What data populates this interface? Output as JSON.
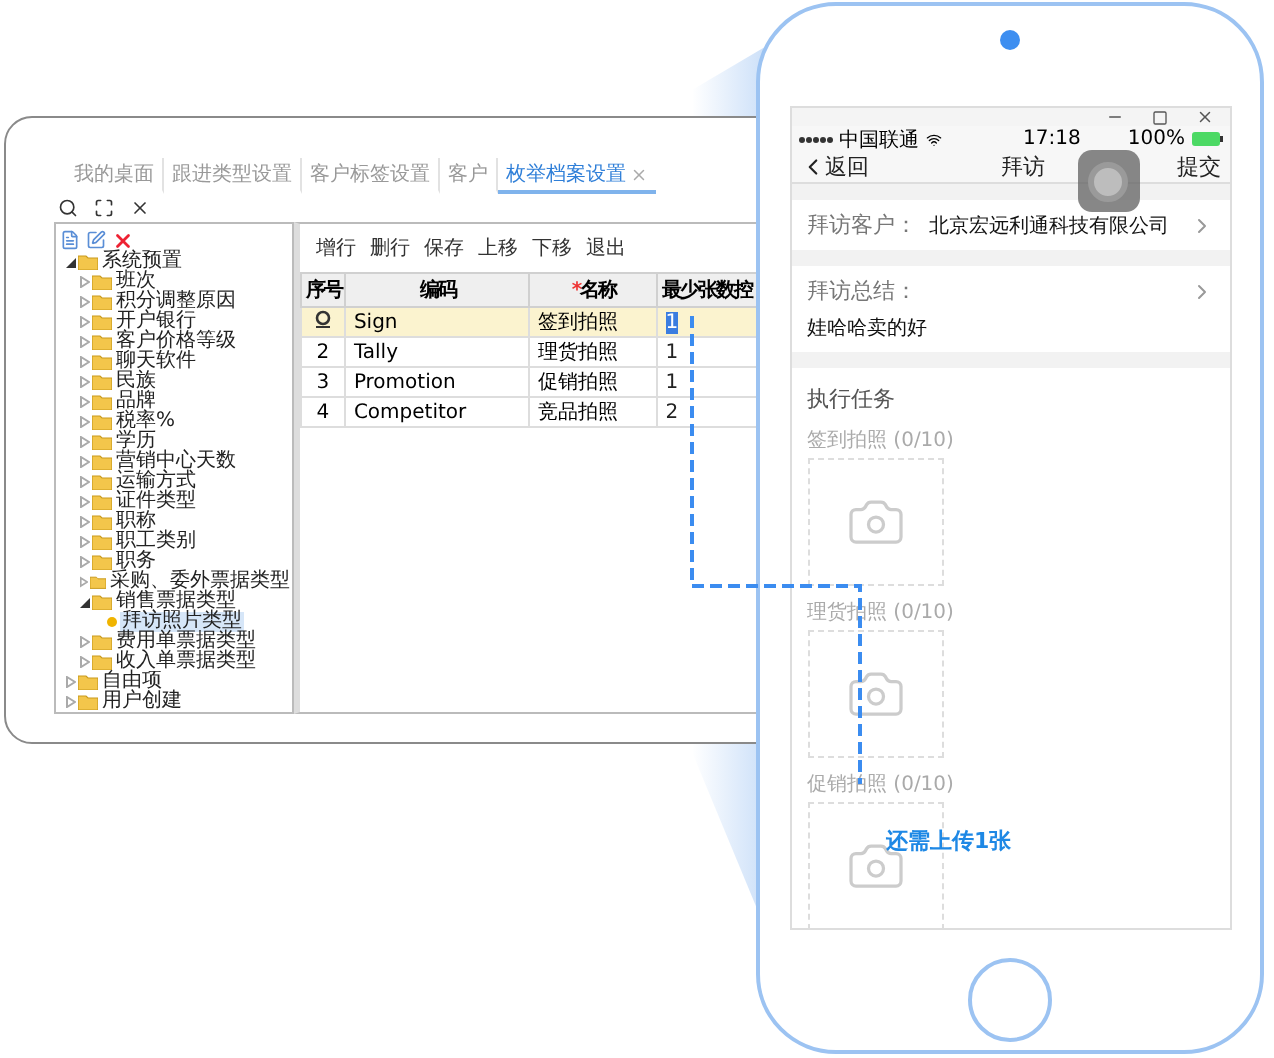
{
  "desktop": {
    "tabs": [
      {
        "label": "我的桌面",
        "selected": false
      },
      {
        "label": "跟进类型设置",
        "selected": false
      },
      {
        "label": "客户标签设置",
        "selected": false
      },
      {
        "label": "客户",
        "selected": false
      },
      {
        "label": "枚举档案设置",
        "selected": true,
        "closable": true
      }
    ],
    "tree": [
      {
        "label": "系统预置",
        "kind": "folder",
        "expanded": true,
        "selected": false,
        "children": [
          {
            "label": "班次",
            "kind": "folder",
            "expanded": false,
            "selected": false
          },
          {
            "label": "积分调整原因",
            "kind": "folder",
            "expanded": false,
            "selected": false
          },
          {
            "label": "开户银行",
            "kind": "folder",
            "expanded": false,
            "selected": false
          },
          {
            "label": "客户价格等级",
            "kind": "folder",
            "expanded": false,
            "selected": false
          },
          {
            "label": "聊天软件",
            "kind": "folder",
            "expanded": false,
            "selected": false
          },
          {
            "label": "民族",
            "kind": "folder",
            "expanded": false,
            "selected": false
          },
          {
            "label": "品牌",
            "kind": "folder",
            "expanded": false,
            "selected": false
          },
          {
            "label": "税率%",
            "kind": "folder",
            "expanded": false,
            "selected": false
          },
          {
            "label": "学历",
            "kind": "folder",
            "expanded": false,
            "selected": false
          },
          {
            "label": "营销中心天数",
            "kind": "folder",
            "expanded": false,
            "selected": false
          },
          {
            "label": "运输方式",
            "kind": "folder",
            "expanded": false,
            "selected": false
          },
          {
            "label": "证件类型",
            "kind": "folder",
            "expanded": false,
            "selected": false
          },
          {
            "label": "职称",
            "kind": "folder",
            "expanded": false,
            "selected": false
          },
          {
            "label": "职工类别",
            "kind": "folder",
            "expanded": false,
            "selected": false
          },
          {
            "label": "职务",
            "kind": "folder",
            "expanded": false,
            "selected": false
          },
          {
            "label": "采购、委外票据类型",
            "kind": "folder",
            "expanded": false,
            "selected": false
          },
          {
            "label": "销售票据类型",
            "kind": "folder",
            "expanded": true,
            "selected": false,
            "children": [
              {
                "label": "拜访照片类型",
                "kind": "item",
                "selected": true
              }
            ]
          },
          {
            "label": "费用单票据类型",
            "kind": "folder",
            "expanded": false,
            "selected": false
          },
          {
            "label": "收入单票据类型",
            "kind": "folder",
            "expanded": false,
            "selected": false
          }
        ]
      },
      {
        "label": "自由项",
        "kind": "folder",
        "expanded": false,
        "selected": false
      },
      {
        "label": "用户创建",
        "kind": "folder",
        "expanded": false,
        "selected": false
      }
    ],
    "toolbar": [
      "增行",
      "删行",
      "保存",
      "上移",
      "下移",
      "退出"
    ],
    "table": {
      "columns": [
        {
          "label": "序号"
        },
        {
          "label": "编码"
        },
        {
          "label": "名称",
          "marker": "*"
        },
        {
          "label": "最少张数控"
        }
      ],
      "rows": [
        {
          "code": "Sign",
          "name": "签到拍照",
          "min": "1",
          "selected": true,
          "editing": true
        },
        {
          "no": "2",
          "code": "Tally",
          "name": "理货拍照",
          "min": "1",
          "selected": false,
          "editing": false
        },
        {
          "no": "3",
          "code": "Promotion",
          "name": "促销拍照",
          "min": "1",
          "selected": false,
          "editing": false
        },
        {
          "no": "4",
          "code": "Competitor",
          "name": "竞品拍照",
          "min": "2",
          "selected": false,
          "editing": false
        }
      ]
    }
  },
  "phone": {
    "status": {
      "carrier": "中国联通",
      "time": "17:18",
      "battery": "100%"
    },
    "nav": {
      "back": "返回",
      "title": "拜访",
      "action": "提交"
    },
    "customer": {
      "label": "拜访客户：",
      "value": "北京宏远利通科技有限公司"
    },
    "summary": {
      "label": "拜访总结：",
      "value": "娃哈哈卖的好"
    },
    "tasks": {
      "title": "执行任务",
      "items": [
        {
          "label": "签到拍照 (0/10)"
        },
        {
          "label": "理货拍照 (0/10)"
        },
        {
          "label": "促销拍照 (0/10)"
        }
      ]
    }
  },
  "annotation": "还需上传1张"
}
